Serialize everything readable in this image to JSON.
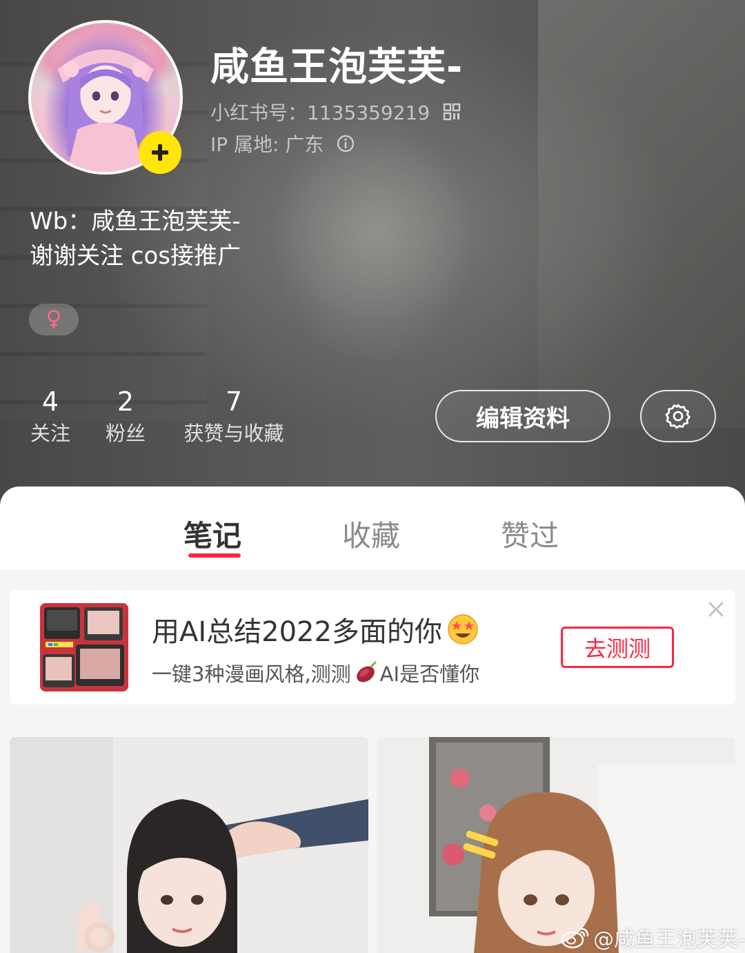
{
  "profile": {
    "nickname": "咸鱼王泡芙芙-",
    "redbook_id": "小红书号：1135359219",
    "ip_location": "IP 属地: 广东",
    "bio_line1": "Wb：咸鱼王泡芙芙-",
    "bio_line2": "谢谢关注 cos接推广",
    "gender": "female"
  },
  "stats": [
    {
      "value": "4",
      "label": "关注"
    },
    {
      "value": "2",
      "label": "粉丝"
    },
    {
      "value": "7",
      "label": "获赞与收藏"
    }
  ],
  "actions": {
    "edit_label": "编辑资料"
  },
  "tabs": [
    {
      "label": "笔记",
      "active": true
    },
    {
      "label": "收藏",
      "active": false
    },
    {
      "label": "赞过",
      "active": false
    }
  ],
  "banner": {
    "title": "用AI总结2022多面的你",
    "subtitle_part1": "一键3种漫画风格,测测",
    "subtitle_part2": "AI是否懂你",
    "cta_label": "去测测",
    "title_emoji": "star-struck-emoji",
    "subtitle_emoji": "sweet-potato-emoji"
  },
  "watermark": "@咸鱼王泡芙芙-",
  "colors": {
    "accent": "#ff2442",
    "add_button": "#ffe50a"
  }
}
